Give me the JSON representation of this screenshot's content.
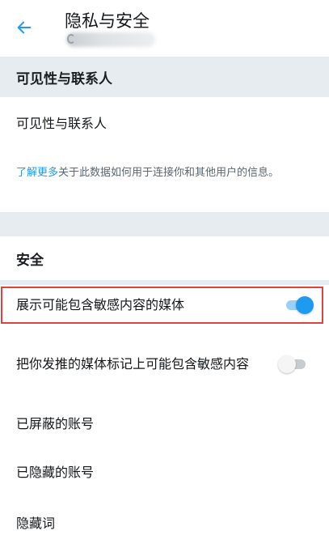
{
  "header": {
    "title": "隐私与安全",
    "back_icon": "arrow-left-icon",
    "accent": "#1d9bf0"
  },
  "visibility_section": {
    "title": "可见性与联系人",
    "row_label": "可见性与联系人",
    "info_link": "了解更多",
    "info_text": "关于此数据如何用于连接你和其他用户的信息。"
  },
  "security_section": {
    "title": "安全",
    "items": [
      {
        "label": "展示可能包含敏感内容的媒体",
        "toggle": true
      },
      {
        "label": "把你发推的媒体标记上可能包含敏感内容",
        "toggle": false
      },
      {
        "label": "已屏蔽的账号"
      },
      {
        "label": "已隐藏的账号"
      },
      {
        "label": "隐藏词"
      }
    ]
  },
  "colors": {
    "section_bg": "#e6ecf0",
    "toggle_on": "#1d9bf0",
    "toggle_off": "#c7ccd1",
    "highlight": "#e0433b"
  }
}
